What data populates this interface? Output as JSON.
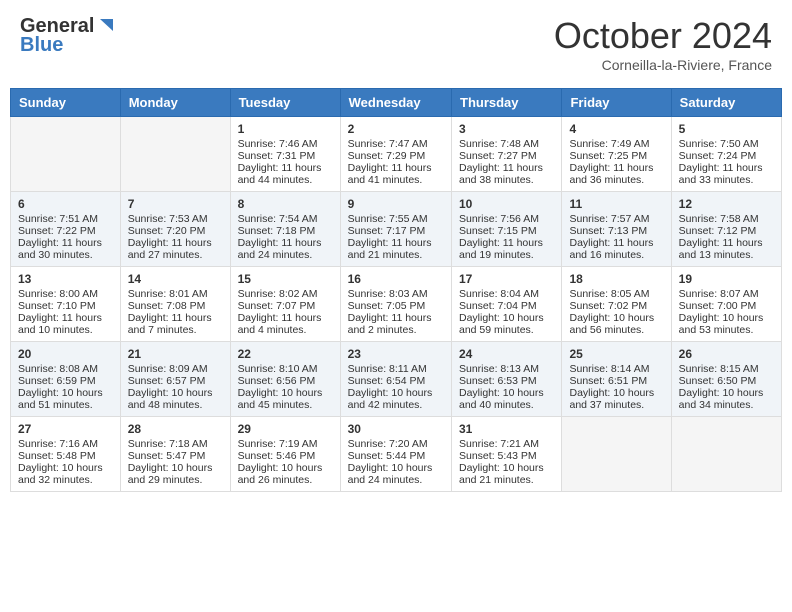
{
  "header": {
    "logo_general": "General",
    "logo_blue": "Blue",
    "title": "October 2024",
    "subtitle": "Corneilla-la-Riviere, France"
  },
  "days_of_week": [
    "Sunday",
    "Monday",
    "Tuesday",
    "Wednesday",
    "Thursday",
    "Friday",
    "Saturday"
  ],
  "weeks": [
    [
      {
        "day": "",
        "sunrise": "",
        "sunset": "",
        "daylight": ""
      },
      {
        "day": "",
        "sunrise": "",
        "sunset": "",
        "daylight": ""
      },
      {
        "day": "1",
        "sunrise": "Sunrise: 7:46 AM",
        "sunset": "Sunset: 7:31 PM",
        "daylight": "Daylight: 11 hours and 44 minutes."
      },
      {
        "day": "2",
        "sunrise": "Sunrise: 7:47 AM",
        "sunset": "Sunset: 7:29 PM",
        "daylight": "Daylight: 11 hours and 41 minutes."
      },
      {
        "day": "3",
        "sunrise": "Sunrise: 7:48 AM",
        "sunset": "Sunset: 7:27 PM",
        "daylight": "Daylight: 11 hours and 38 minutes."
      },
      {
        "day": "4",
        "sunrise": "Sunrise: 7:49 AM",
        "sunset": "Sunset: 7:25 PM",
        "daylight": "Daylight: 11 hours and 36 minutes."
      },
      {
        "day": "5",
        "sunrise": "Sunrise: 7:50 AM",
        "sunset": "Sunset: 7:24 PM",
        "daylight": "Daylight: 11 hours and 33 minutes."
      }
    ],
    [
      {
        "day": "6",
        "sunrise": "Sunrise: 7:51 AM",
        "sunset": "Sunset: 7:22 PM",
        "daylight": "Daylight: 11 hours and 30 minutes."
      },
      {
        "day": "7",
        "sunrise": "Sunrise: 7:53 AM",
        "sunset": "Sunset: 7:20 PM",
        "daylight": "Daylight: 11 hours and 27 minutes."
      },
      {
        "day": "8",
        "sunrise": "Sunrise: 7:54 AM",
        "sunset": "Sunset: 7:18 PM",
        "daylight": "Daylight: 11 hours and 24 minutes."
      },
      {
        "day": "9",
        "sunrise": "Sunrise: 7:55 AM",
        "sunset": "Sunset: 7:17 PM",
        "daylight": "Daylight: 11 hours and 21 minutes."
      },
      {
        "day": "10",
        "sunrise": "Sunrise: 7:56 AM",
        "sunset": "Sunset: 7:15 PM",
        "daylight": "Daylight: 11 hours and 19 minutes."
      },
      {
        "day": "11",
        "sunrise": "Sunrise: 7:57 AM",
        "sunset": "Sunset: 7:13 PM",
        "daylight": "Daylight: 11 hours and 16 minutes."
      },
      {
        "day": "12",
        "sunrise": "Sunrise: 7:58 AM",
        "sunset": "Sunset: 7:12 PM",
        "daylight": "Daylight: 11 hours and 13 minutes."
      }
    ],
    [
      {
        "day": "13",
        "sunrise": "Sunrise: 8:00 AM",
        "sunset": "Sunset: 7:10 PM",
        "daylight": "Daylight: 11 hours and 10 minutes."
      },
      {
        "day": "14",
        "sunrise": "Sunrise: 8:01 AM",
        "sunset": "Sunset: 7:08 PM",
        "daylight": "Daylight: 11 hours and 7 minutes."
      },
      {
        "day": "15",
        "sunrise": "Sunrise: 8:02 AM",
        "sunset": "Sunset: 7:07 PM",
        "daylight": "Daylight: 11 hours and 4 minutes."
      },
      {
        "day": "16",
        "sunrise": "Sunrise: 8:03 AM",
        "sunset": "Sunset: 7:05 PM",
        "daylight": "Daylight: 11 hours and 2 minutes."
      },
      {
        "day": "17",
        "sunrise": "Sunrise: 8:04 AM",
        "sunset": "Sunset: 7:04 PM",
        "daylight": "Daylight: 10 hours and 59 minutes."
      },
      {
        "day": "18",
        "sunrise": "Sunrise: 8:05 AM",
        "sunset": "Sunset: 7:02 PM",
        "daylight": "Daylight: 10 hours and 56 minutes."
      },
      {
        "day": "19",
        "sunrise": "Sunrise: 8:07 AM",
        "sunset": "Sunset: 7:00 PM",
        "daylight": "Daylight: 10 hours and 53 minutes."
      }
    ],
    [
      {
        "day": "20",
        "sunrise": "Sunrise: 8:08 AM",
        "sunset": "Sunset: 6:59 PM",
        "daylight": "Daylight: 10 hours and 51 minutes."
      },
      {
        "day": "21",
        "sunrise": "Sunrise: 8:09 AM",
        "sunset": "Sunset: 6:57 PM",
        "daylight": "Daylight: 10 hours and 48 minutes."
      },
      {
        "day": "22",
        "sunrise": "Sunrise: 8:10 AM",
        "sunset": "Sunset: 6:56 PM",
        "daylight": "Daylight: 10 hours and 45 minutes."
      },
      {
        "day": "23",
        "sunrise": "Sunrise: 8:11 AM",
        "sunset": "Sunset: 6:54 PM",
        "daylight": "Daylight: 10 hours and 42 minutes."
      },
      {
        "day": "24",
        "sunrise": "Sunrise: 8:13 AM",
        "sunset": "Sunset: 6:53 PM",
        "daylight": "Daylight: 10 hours and 40 minutes."
      },
      {
        "day": "25",
        "sunrise": "Sunrise: 8:14 AM",
        "sunset": "Sunset: 6:51 PM",
        "daylight": "Daylight: 10 hours and 37 minutes."
      },
      {
        "day": "26",
        "sunrise": "Sunrise: 8:15 AM",
        "sunset": "Sunset: 6:50 PM",
        "daylight": "Daylight: 10 hours and 34 minutes."
      }
    ],
    [
      {
        "day": "27",
        "sunrise": "Sunrise: 7:16 AM",
        "sunset": "Sunset: 5:48 PM",
        "daylight": "Daylight: 10 hours and 32 minutes."
      },
      {
        "day": "28",
        "sunrise": "Sunrise: 7:18 AM",
        "sunset": "Sunset: 5:47 PM",
        "daylight": "Daylight: 10 hours and 29 minutes."
      },
      {
        "day": "29",
        "sunrise": "Sunrise: 7:19 AM",
        "sunset": "Sunset: 5:46 PM",
        "daylight": "Daylight: 10 hours and 26 minutes."
      },
      {
        "day": "30",
        "sunrise": "Sunrise: 7:20 AM",
        "sunset": "Sunset: 5:44 PM",
        "daylight": "Daylight: 10 hours and 24 minutes."
      },
      {
        "day": "31",
        "sunrise": "Sunrise: 7:21 AM",
        "sunset": "Sunset: 5:43 PM",
        "daylight": "Daylight: 10 hours and 21 minutes."
      },
      {
        "day": "",
        "sunrise": "",
        "sunset": "",
        "daylight": ""
      },
      {
        "day": "",
        "sunrise": "",
        "sunset": "",
        "daylight": ""
      }
    ]
  ]
}
